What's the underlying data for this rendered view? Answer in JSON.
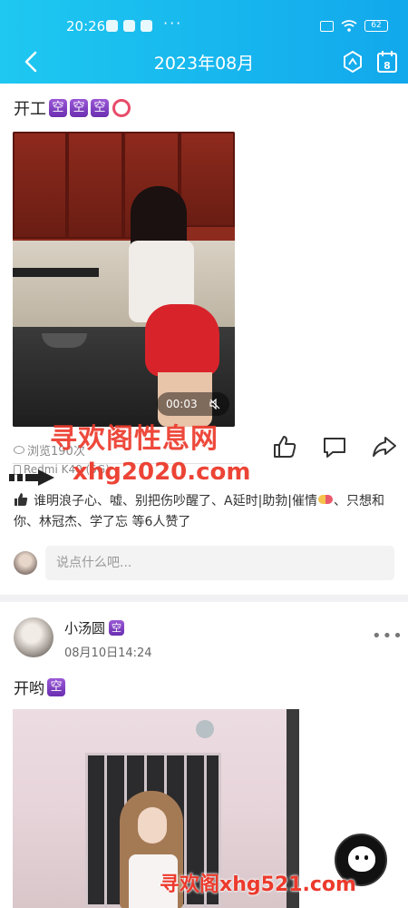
{
  "status_bar": {
    "time": "20:26",
    "dots": "···",
    "battery": "62"
  },
  "header": {
    "title": "2023年08月"
  },
  "post1": {
    "title": "开工",
    "video_time": "00:03",
    "views": "浏览190次",
    "device": "Redmi K40 (5G)",
    "likes_text_1": "谁明浪子心、嘘、别把伤吵醒了、A延时|助勃|催情",
    "likes_text_2": "、只想和你、林冠杰、学了忘 等6人赞了",
    "comment_placeholder": "说点什么吧..."
  },
  "post2": {
    "author": "小汤圆",
    "date": "08月10日14:24",
    "title": "开哟",
    "more": "•••"
  },
  "badges": {
    "kong": "空"
  },
  "watermarks": {
    "top": "寻欢阁性息网",
    "mid": "xhg2020.com",
    "bottom": "寻欢阁xhg521.com"
  },
  "colors": {
    "header_start": "#1ec8f0",
    "header_end": "#12a8ec",
    "watermark": "#ec3a2c",
    "badge": "#7b3fc4"
  },
  "icons": {
    "back": "chevron-left-icon",
    "hexagon": "hexagon-icon",
    "calendar": "calendar-icon",
    "like": "thumbs-up-icon",
    "comment": "comment-icon",
    "share": "share-icon",
    "calendar_day": "8"
  }
}
